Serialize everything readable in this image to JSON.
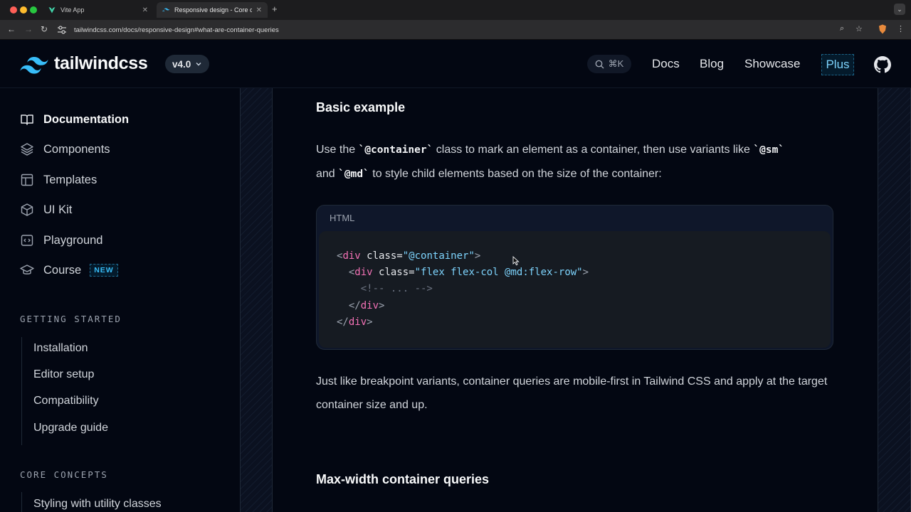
{
  "browser": {
    "tabs": [
      {
        "title": "Vite App",
        "active": false
      },
      {
        "title": "Responsive design - Core co",
        "active": true
      }
    ],
    "url": "tailwindcss.com/docs/responsive-design#what-are-container-queries"
  },
  "header": {
    "brand": "tailwindcss",
    "version": "v4.0",
    "search_shortcut": "⌘K",
    "nav": [
      "Docs",
      "Blog",
      "Showcase"
    ],
    "plus": "Plus"
  },
  "sidebar": {
    "primary": [
      {
        "label": "Documentation",
        "icon": "book-icon",
        "active": true
      },
      {
        "label": "Components",
        "icon": "layers-icon"
      },
      {
        "label": "Templates",
        "icon": "layout-icon"
      },
      {
        "label": "UI Kit",
        "icon": "cube-icon"
      },
      {
        "label": "Playground",
        "icon": "code-icon"
      },
      {
        "label": "Course",
        "icon": "graduation-cap-icon",
        "badge": "NEW"
      }
    ],
    "sections": [
      {
        "heading": "GETTING STARTED",
        "items": [
          "Installation",
          "Editor setup",
          "Compatibility",
          "Upgrade guide"
        ]
      },
      {
        "heading": "CORE CONCEPTS",
        "items": [
          "Styling with utility classes"
        ]
      }
    ]
  },
  "content": {
    "heading1": "Basic example",
    "para1": {
      "t1": "Use the ",
      "c1": "`@container`",
      "t2": " class to mark an element as a container, then use variants like ",
      "c2": "`@sm`",
      "t3": "and ",
      "c3": "`@md`",
      "t4": " to style child elements based on the size of the container:"
    },
    "code": {
      "lang": "HTML",
      "line1": {
        "open": "<",
        "tag": "div",
        "attr": " class=",
        "val": "\"@container\"",
        "close": ">"
      },
      "line2": {
        "open": "<",
        "tag": "div",
        "attr": " class=",
        "val": "\"flex flex-col @md:flex-row\"",
        "close": ">"
      },
      "line3": "<!-- ... -->",
      "line4": {
        "open": "</",
        "tag": "div",
        "close": ">"
      },
      "line5": {
        "open": "</",
        "tag": "div",
        "close": ">"
      }
    },
    "para2": "Just like breakpoint variants, container queries are mobile-first in Tailwind CSS and apply at the target container size and up.",
    "heading2": "Max-width container queries"
  }
}
